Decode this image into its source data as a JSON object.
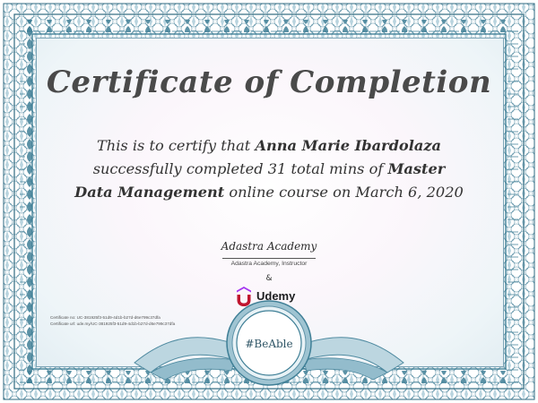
{
  "certificate": {
    "title": "Certificate of Completion",
    "statement_intro": "This is to certify that",
    "recipient": "Anna Marie Ibardolaza",
    "statement_middle": "successfully completed 31 total mins of",
    "course_line1": "Master",
    "course_line2": "Data Management",
    "statement_end": "online course on March 6, 2020",
    "signature": "Adastra Academy",
    "instructor": "Adastra Academy, Instructor",
    "ampersand": "&",
    "brand": "Udemy",
    "certificate_no": "Certificate no: UC-381925f3-51d9-4d1b-b27d-d6e799c37dfa",
    "certificate_url": "Certificate url: ude.my/UC-381925f3-51d9-4d1b-b27d-d6e799c37dfa",
    "seal_text": "#BeAble"
  },
  "colors": {
    "frame": "#3f7f96",
    "frame_light": "#a9cbd8",
    "title": "#4a4a4a",
    "brand_accent": "#a435f0"
  }
}
